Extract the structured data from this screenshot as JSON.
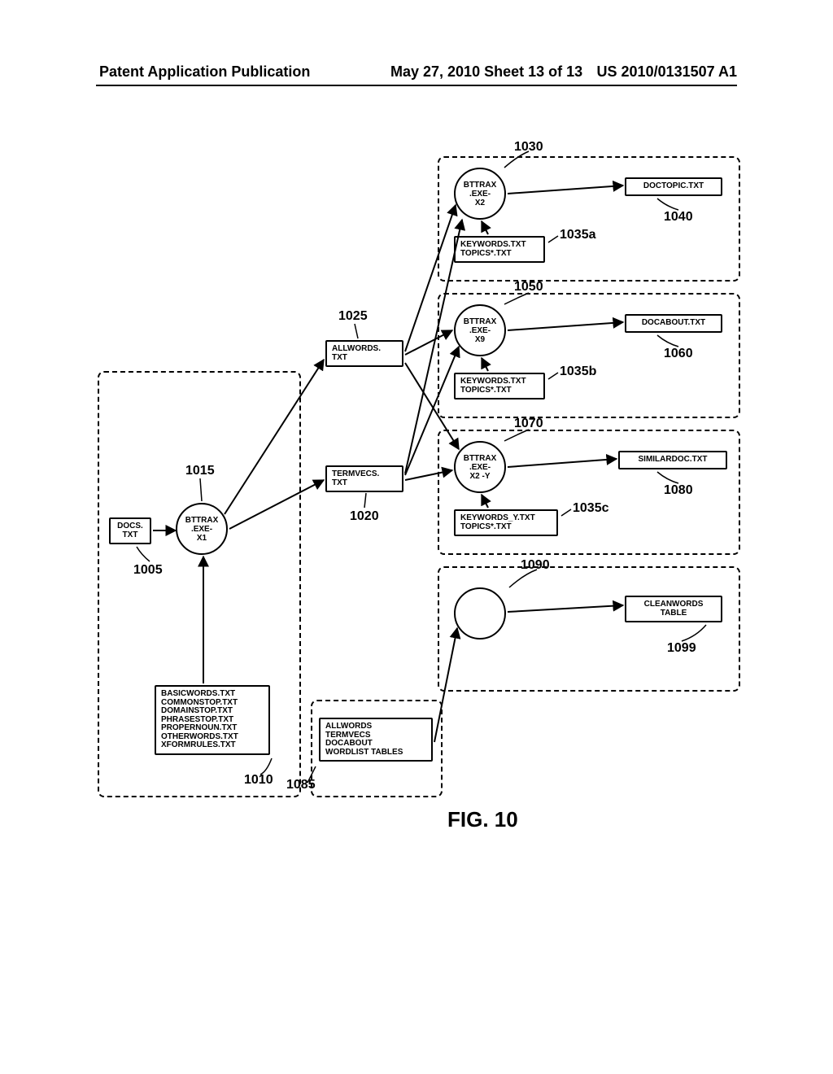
{
  "header": {
    "left": "Patent Application Publication",
    "mid": "May 27, 2010  Sheet 13 of 13",
    "right": "US 2010/0131507 A1"
  },
  "refnums": {
    "r1005": "1005",
    "r1010": "1010",
    "r1015": "1015",
    "r1020": "1020",
    "r1025": "1025",
    "r1030": "1030",
    "r1035a": "1035a",
    "r1035b": "1035b",
    "r1035c": "1035c",
    "r1040": "1040",
    "r1050": "1050",
    "r1060": "1060",
    "r1070": "1070",
    "r1080": "1080",
    "r1085": "1085",
    "r1090": "1090",
    "r1099": "1099"
  },
  "nodes": {
    "docs": "DOCS.\nTXT",
    "bttrax_x1": "BTTRAX\n.EXE-\nX1",
    "wordlists": "BASICWORDS.TXT\nCOMMONSTOP.TXT\nDOMAINSTOP.TXT\nPHRASESTOP.TXT\nPROPERNOUN.TXT\nOTHERWORDS.TXT\nXFORMRULES.TXT",
    "allwords": "ALLWORDS.\nTXT",
    "termvecs": "TERMVECS.\nTXT",
    "bttrax_x2": "BTTRAX\n.EXE-\nX2",
    "key_a": "KEYWORDS.TXT\nTOPICS*.TXT",
    "doctopic": "DOCTOPIC.TXT",
    "bttrax_x9": "BTTRAX\n.EXE-\nX9",
    "key_b": "KEYWORDS.TXT\nTOPICS*.TXT",
    "docabout": "DOCABOUT.TXT",
    "bttrax_x2y": "BTTRAX\n.EXE-\nX2 -Y",
    "key_c": "KEYWORDS_Y.TXT\nTOPICS*.TXT",
    "similar": "SIMILARDOC.TXT",
    "tables": "ALLWORDS\nTERMVECS\nDOCABOUT\nWORDLIST TABLES",
    "clean": "CLEANWORDS\nTABLE"
  },
  "figure_caption": "FIG. 10"
}
